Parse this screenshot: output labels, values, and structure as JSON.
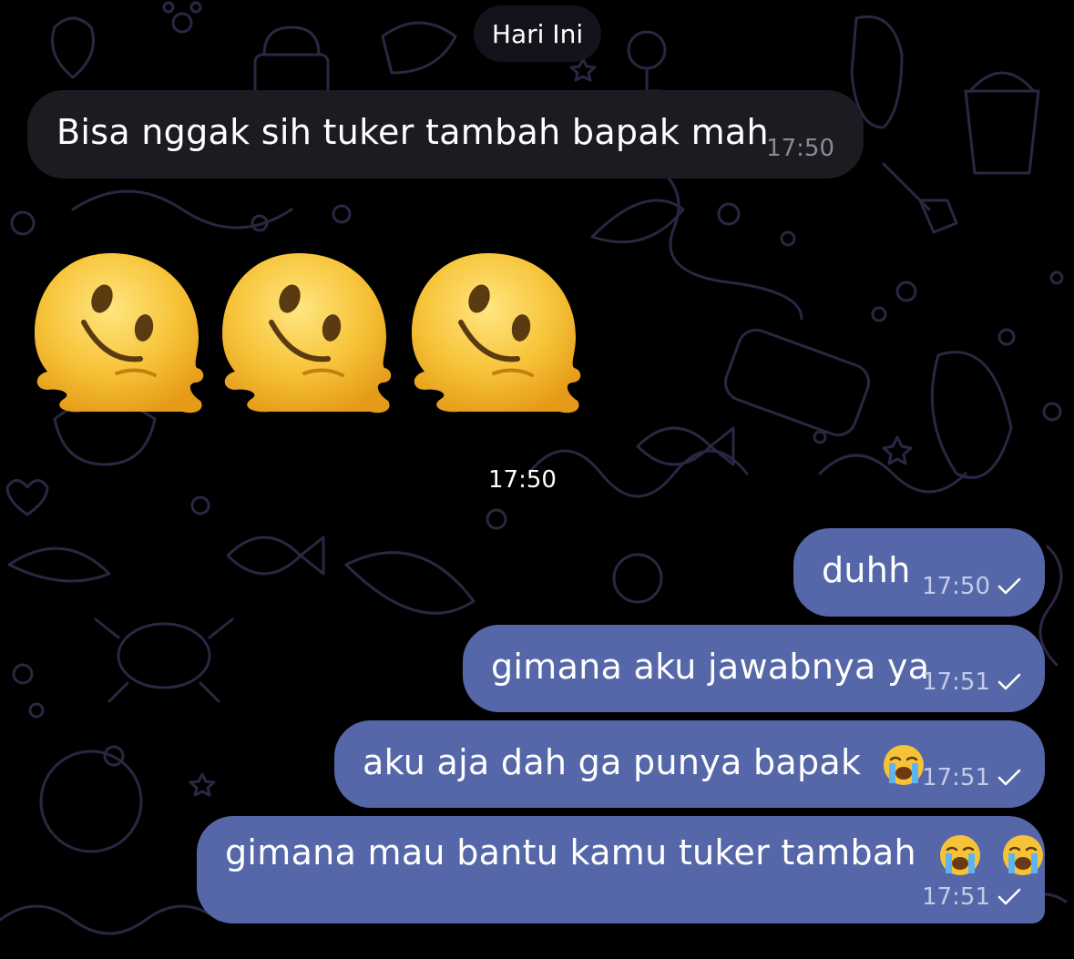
{
  "chat": {
    "date_separator": "Hari Ini",
    "messages": [
      {
        "direction": "incoming",
        "text": "Bisa nggak sih tuker tambah bapak mah",
        "time": "17:50"
      },
      {
        "direction": "incoming",
        "type": "emoji",
        "emoji_icons": [
          "melting-face-icon",
          "melting-face-icon",
          "melting-face-icon"
        ],
        "time": "17:50"
      },
      {
        "direction": "outgoing",
        "text": "duhh",
        "time": "17:50",
        "status_icon": "check-icon"
      },
      {
        "direction": "outgoing",
        "text": "gimana aku jawabnya ya",
        "time": "17:51",
        "status_icon": "check-icon"
      },
      {
        "direction": "outgoing",
        "text": "aku aja dah ga punya bapak",
        "emoji_icons": [
          "crying-face-icon"
        ],
        "time": "17:51",
        "status_icon": "check-icon"
      },
      {
        "direction": "outgoing",
        "text": "gimana mau bantu kamu tuker tambah",
        "emoji_icons": [
          "crying-face-icon",
          "crying-face-icon"
        ],
        "time": "17:51",
        "status_icon": "check-icon"
      }
    ]
  },
  "colors": {
    "background": "#000000",
    "incoming_bubble": "#1c1b22",
    "outgoing_bubble": "#5567a8",
    "wallpaper_doodle": "#2a2540"
  }
}
